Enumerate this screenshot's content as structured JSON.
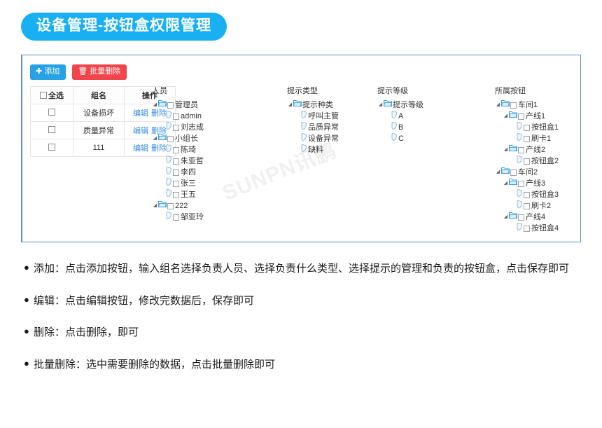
{
  "page": {
    "title_badge": "设备管理-按钮盒权限管理",
    "watermark": "SUNPN讯鹏"
  },
  "toolbar": {
    "add_icon": "plus-icon",
    "add_label": "添加",
    "batch_delete_icon": "trash-icon",
    "batch_delete_label": "批量删除"
  },
  "table": {
    "headers": {
      "select_all": "全选",
      "group_name": "组名",
      "operation": "操作"
    },
    "rows": [
      {
        "group_name": "设备损坏",
        "edit": "编辑",
        "delete": "删除",
        "checked": false
      },
      {
        "group_name": "质量异常",
        "edit": "编辑",
        "delete": "删除",
        "checked": false
      },
      {
        "group_name": "111",
        "edit": "编辑",
        "delete": "删除",
        "checked": false
      }
    ]
  },
  "trees": {
    "personnel": {
      "title": "人员",
      "nodes": [
        {
          "label": "管理员",
          "level": 0,
          "type": "folder",
          "expanded": true,
          "checkbox": true
        },
        {
          "label": "admin",
          "level": 1,
          "type": "leaf",
          "checkbox": true
        },
        {
          "label": "刘志成",
          "level": 1,
          "type": "leaf",
          "checkbox": true
        },
        {
          "label": "小组长",
          "level": 0,
          "type": "folder",
          "expanded": true,
          "checkbox": true
        },
        {
          "label": "陈琦",
          "level": 1,
          "type": "leaf",
          "checkbox": true
        },
        {
          "label": "朱亚哲",
          "level": 1,
          "type": "leaf",
          "checkbox": true
        },
        {
          "label": "李四",
          "level": 1,
          "type": "leaf",
          "checkbox": true
        },
        {
          "label": "张三",
          "level": 1,
          "type": "leaf",
          "checkbox": true
        },
        {
          "label": "王五",
          "level": 1,
          "type": "leaf",
          "checkbox": true
        },
        {
          "label": "222",
          "level": 0,
          "type": "folder",
          "expanded": true,
          "checkbox": true
        },
        {
          "label": "邹亚玲",
          "level": 1,
          "type": "leaf",
          "checkbox": true
        }
      ]
    },
    "alert_type": {
      "title": "提示类型",
      "nodes": [
        {
          "label": "提示种类",
          "level": 0,
          "type": "folder",
          "expanded": true,
          "checkbox": false
        },
        {
          "label": "呼叫主管",
          "level": 1,
          "type": "leaf",
          "checkbox": false
        },
        {
          "label": "品质异常",
          "level": 1,
          "type": "leaf",
          "checkbox": false
        },
        {
          "label": "设备异常",
          "level": 1,
          "type": "leaf",
          "checkbox": false
        },
        {
          "label": "缺料",
          "level": 1,
          "type": "leaf",
          "checkbox": false
        }
      ]
    },
    "alert_level": {
      "title": "提示等级",
      "nodes": [
        {
          "label": "提示等级",
          "level": 0,
          "type": "folder",
          "expanded": true,
          "checkbox": false
        },
        {
          "label": "A",
          "level": 1,
          "type": "leaf",
          "checkbox": false
        },
        {
          "label": "B",
          "level": 1,
          "type": "leaf",
          "checkbox": false
        },
        {
          "label": "C",
          "level": 1,
          "type": "leaf",
          "checkbox": false
        }
      ]
    },
    "buttons": {
      "title": "所属按钮",
      "nodes": [
        {
          "label": "车间1",
          "level": 0,
          "type": "folder",
          "expanded": true,
          "checkbox": true
        },
        {
          "label": "产线1",
          "level": 1,
          "type": "folder",
          "expanded": true,
          "checkbox": true
        },
        {
          "label": "按钮盒1",
          "level": 2,
          "type": "leaf",
          "checkbox": true
        },
        {
          "label": "刷卡1",
          "level": 2,
          "type": "leaf",
          "checkbox": true
        },
        {
          "label": "产线2",
          "level": 1,
          "type": "folder",
          "expanded": true,
          "checkbox": true
        },
        {
          "label": "按钮盒2",
          "level": 2,
          "type": "leaf",
          "checkbox": true
        },
        {
          "label": "车间2",
          "level": 0,
          "type": "folder",
          "expanded": true,
          "checkbox": true
        },
        {
          "label": "产线3",
          "level": 1,
          "type": "folder",
          "expanded": true,
          "checkbox": true
        },
        {
          "label": "按钮盒3",
          "level": 2,
          "type": "leaf",
          "checkbox": true
        },
        {
          "label": "刷卡2",
          "level": 2,
          "type": "leaf",
          "checkbox": true
        },
        {
          "label": "产线4",
          "level": 1,
          "type": "folder",
          "expanded": true,
          "checkbox": true
        },
        {
          "label": "按钮盒4",
          "level": 2,
          "type": "leaf",
          "checkbox": true
        }
      ]
    }
  },
  "notes": [
    "添加：点击添加按钮，输入组名选择负责人员、选择负责什么类型、选择提示的管理和负责的按钮盒，点击保存即可",
    "编辑：点击编辑按钮，修改完数据后，保存即可",
    "删除：点击删除，即可",
    "批量删除：选中需要删除的数据，点击批量删除即可"
  ],
  "colors": {
    "brand_blue": "#18b0f3",
    "button_blue": "#27a2e4",
    "button_red": "#f1444b",
    "link_blue": "#3a8ee6",
    "panel_border": "#5b8fd0"
  }
}
